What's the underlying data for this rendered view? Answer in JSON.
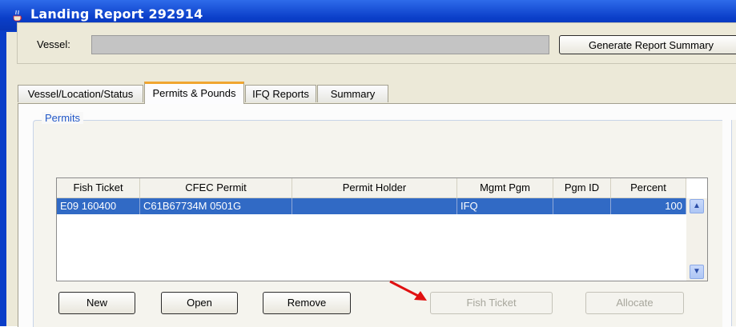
{
  "window": {
    "title": "Landing Report 292914",
    "title_icon": "java-cup-icon",
    "colors": {
      "titlebar": "#0a3ec8",
      "selection": "#316ac5",
      "tab_accent": "#f0a630",
      "legend": "#2157c8"
    }
  },
  "header": {
    "vessel_label": "Vessel:",
    "vessel_value": "",
    "generate_button": "Generate Report Summary"
  },
  "tabs": [
    {
      "label": "Vessel/Location/Status",
      "active": false
    },
    {
      "label": "Permits & Pounds",
      "active": true
    },
    {
      "label": "IFQ Reports",
      "active": false
    },
    {
      "label": "Summary",
      "active": false
    }
  ],
  "permits": {
    "legend": "Permits",
    "columns": [
      "Fish Ticket",
      "CFEC Permit",
      "Permit Holder",
      "Mgmt Pgm",
      "Pgm ID",
      "Percent"
    ],
    "rows": [
      {
        "fish_ticket": "E09 160400",
        "cfec_permit": "C61B67734M 0501G",
        "permit_holder": "",
        "mgmt_pgm": "IFQ",
        "pgm_id": "",
        "percent": "100",
        "selected": true
      }
    ],
    "buttons": {
      "new": "New",
      "open": "Open",
      "remove": "Remove",
      "fish_ticket": "Fish Ticket",
      "allocate": "Allocate"
    }
  },
  "annotation": {
    "arrow_color": "#e01010"
  }
}
